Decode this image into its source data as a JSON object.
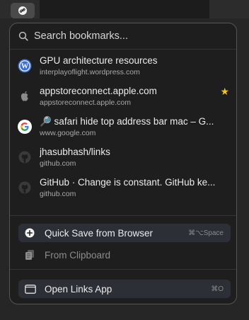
{
  "search": {
    "placeholder": "Search bookmarks..."
  },
  "bookmarks": [
    {
      "title": "GPU architecture resources",
      "url": "interplayoflight.wordpress.com",
      "icon": "wordpress-icon",
      "starred": false
    },
    {
      "title": "appstoreconnect.apple.com",
      "url": "appstoreconnect.apple.com",
      "icon": "apple-icon",
      "starred": true
    },
    {
      "title": "🔎 safari hide top address bar mac – G...",
      "url": "www.google.com",
      "icon": "google-icon",
      "starred": false
    },
    {
      "title": "jhasubhash/links",
      "url": "github.com",
      "icon": "github-icon",
      "starred": false
    },
    {
      "title": "GitHub · Change is constant. GitHub ke...",
      "url": "github.com",
      "icon": "github-icon",
      "starred": false
    }
  ],
  "star_glyph": "★",
  "actions": {
    "quick_save": {
      "label": "Quick Save from Browser",
      "shortcut": "⌘⌥Space"
    },
    "from_clipboard": {
      "label": "From Clipboard"
    },
    "open_app": {
      "label": "Open Links App",
      "shortcut": "⌘O"
    }
  },
  "colors": {
    "panel_bg": "#1e1e1e",
    "star": "#f5c518",
    "wordpress_blue": "#3b6fd1",
    "highlight_bg": "#2c2f36"
  }
}
